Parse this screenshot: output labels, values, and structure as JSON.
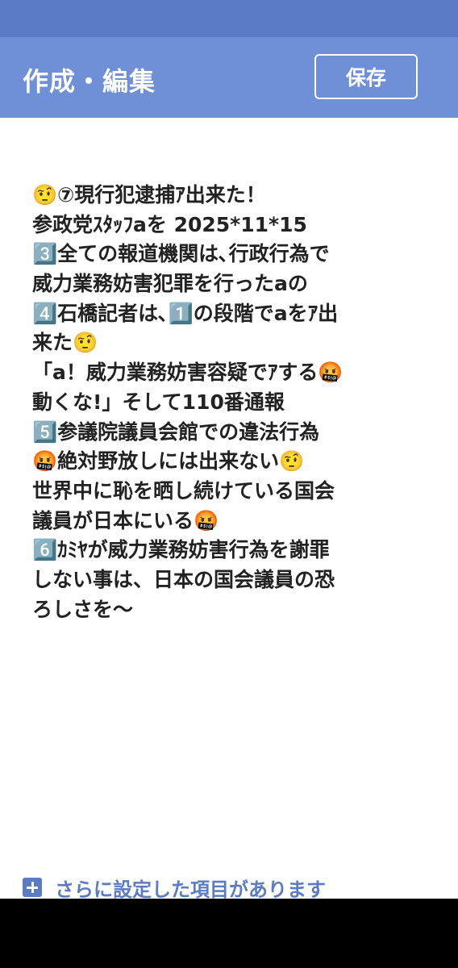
{
  "header": {
    "title": "作成・編集",
    "save_label": "保存"
  },
  "editor": {
    "lines": [
      "🤨⑦現行犯逮捕ｱ出来た！",
      "参政党ｽﾀｯﾌaを 2025*11*15",
      "3️⃣全ての報道機関は､行政行為で",
      "威力業務妨害犯罪を行ったaの",
      "4️⃣石橋記者は､1️⃣の段階でaをｱ出",
      "来た🤨",
      "「a！威力業務妨害容疑でｱする🤬",
      "動くな!」そして110番通報",
      "5️⃣参議院議員会館での違法行為",
      "🤬絶対野放しには出来ない🤨",
      "世界中に恥を晒し続けている国会",
      "議員が日本にいる🤬",
      "6️⃣ｶﾐﾔが威力業務妨害行為を謝罪",
      "しない事は、日本の国会議員の恐",
      "ろしさを～"
    ]
  },
  "footer": {
    "more_settings_label": "さらに設定した項目があります"
  },
  "colors": {
    "status_bar": "#5b7cc4",
    "header": "#6f8fd6",
    "accent": "#5b7cc4"
  }
}
